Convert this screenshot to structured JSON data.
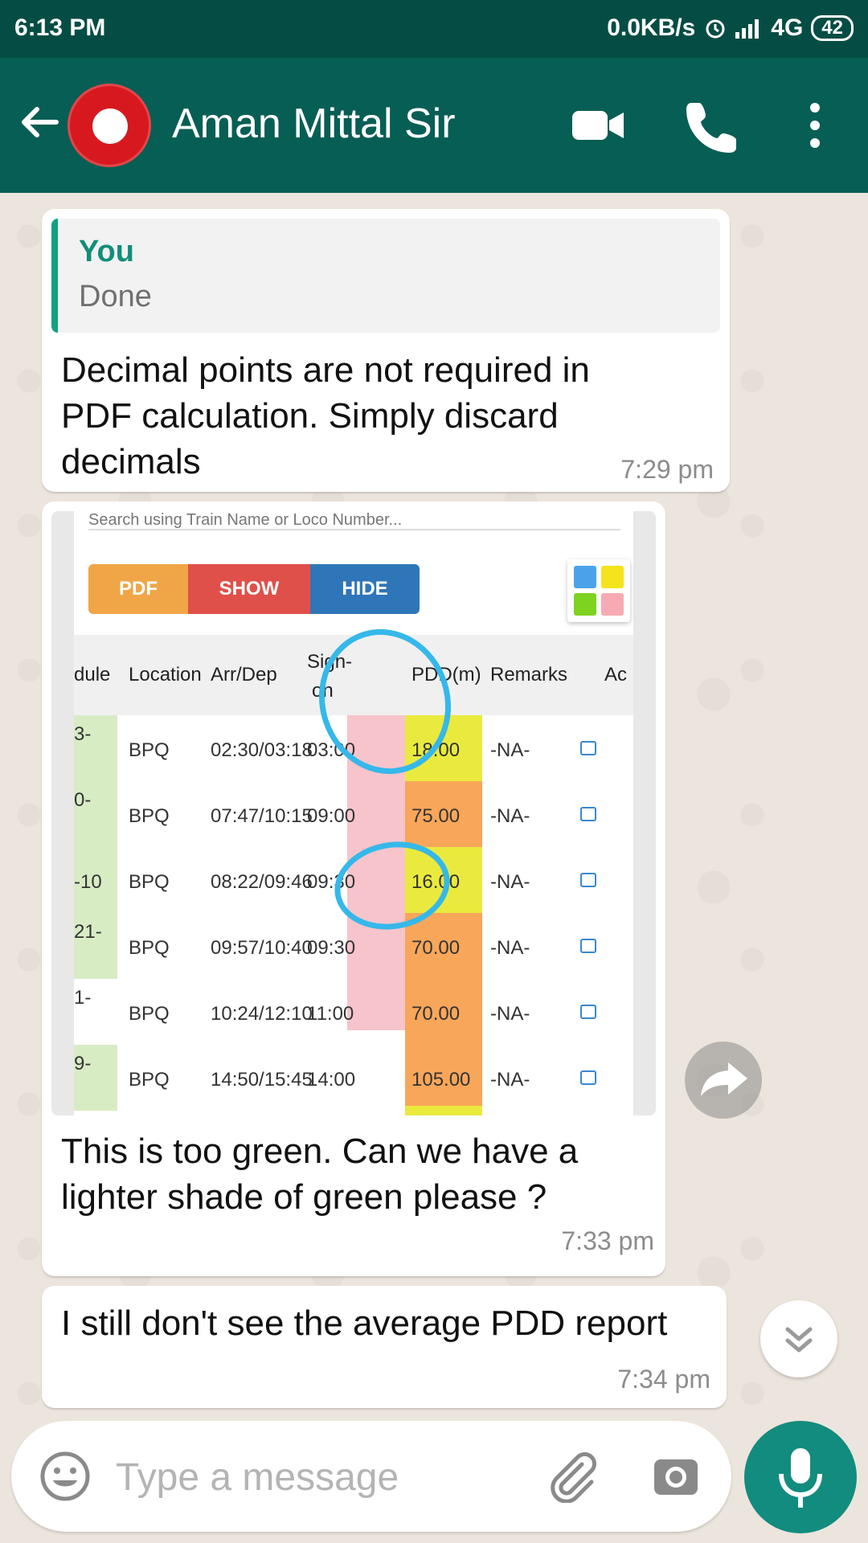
{
  "status_bar": {
    "time": "6:13 PM",
    "speed": "0.0KB/s",
    "network": "4G",
    "battery": "42"
  },
  "header": {
    "contact_name": "Aman Mittal Sir",
    "icons": [
      "back-arrow-icon",
      "video-call-icon",
      "phone-icon",
      "more-vert-icon"
    ]
  },
  "messages": [
    {
      "quote_author": "You",
      "quote_text": "Done",
      "lines": [
        "Decimal points are not required in",
        "PDF calculation. Simply discard",
        "decimals"
      ],
      "time": "7:29 pm"
    },
    {
      "image": {
        "search_placeholder": "Search using Train Name or Loco Number...",
        "buttons": [
          "PDF",
          "SHOW",
          "HIDE"
        ],
        "legend_colors": [
          "#4aa3ea",
          "#f4e41c",
          "#7ed321",
          "#f7aab4"
        ],
        "headers": [
          "dule",
          "Location",
          "Arr/Dep",
          "Sign-",
          "on",
          "PDD(m)",
          "Remarks",
          "Ac"
        ],
        "rows": [
          {
            "schedule": "3-",
            "location": "BPQ",
            "arr_dep": "02:30/03:18",
            "sign_on": "03:00",
            "pdd": "18.00",
            "remarks": "-NA-"
          },
          {
            "schedule": "0-",
            "location": "BPQ",
            "arr_dep": "07:47/10:15",
            "sign_on": "09:00",
            "pdd": "75.00",
            "remarks": "-NA-"
          },
          {
            "schedule": "-10",
            "location": "BPQ",
            "arr_dep": "08:22/09:46",
            "sign_on": "09:30",
            "pdd": "16.00",
            "remarks": "-NA-"
          },
          {
            "schedule": "21-",
            "location": "BPQ",
            "arr_dep": "09:57/10:40",
            "sign_on": "09:30",
            "pdd": "70.00",
            "remarks": "-NA-"
          },
          {
            "schedule": "1-",
            "location": "BPQ",
            "arr_dep": "10:24/12:10",
            "sign_on": "11:00",
            "pdd": "70.00",
            "remarks": "-NA-"
          },
          {
            "schedule": "9-",
            "location": "BPQ",
            "arr_dep": "14:50/15:45",
            "sign_on": "14:00",
            "pdd": "105.00",
            "remarks": "-NA-"
          }
        ]
      },
      "lines": [
        "This is too green. Can we have a",
        "lighter shade of green please ?"
      ],
      "time": "7:33 pm"
    },
    {
      "lines": [
        "I still don't see the average PDD report"
      ],
      "time": "7:34 pm"
    }
  ],
  "composer": {
    "placeholder": "Type a message"
  },
  "colors": {
    "header": "#075e54",
    "status": "#054d44",
    "accent": "#128c7e",
    "quote_bar": "#11a182"
  }
}
